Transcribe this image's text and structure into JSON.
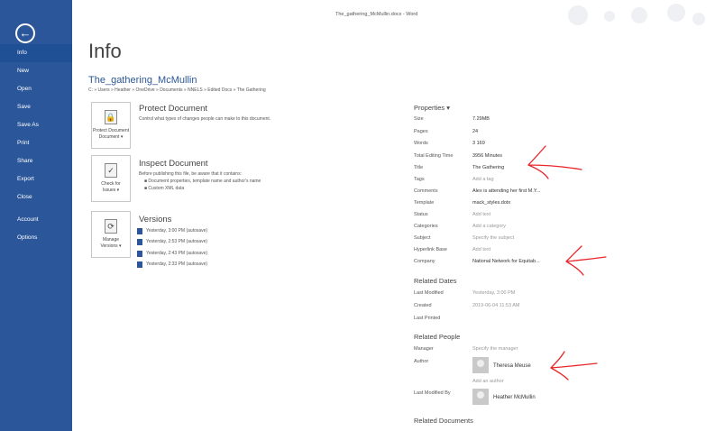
{
  "window": {
    "title": "The_gathering_McMullin.docx - Word"
  },
  "sidebar": {
    "back_icon": "back-arrow-icon",
    "items": [
      {
        "label": "Info",
        "active": true
      },
      {
        "label": "New"
      },
      {
        "label": "Open"
      },
      {
        "label": "Save"
      },
      {
        "label": "Save As"
      },
      {
        "label": "Print"
      },
      {
        "label": "Share"
      },
      {
        "label": "Export"
      },
      {
        "label": "Close"
      },
      {
        "label": "Account"
      },
      {
        "label": "Options"
      }
    ]
  },
  "main": {
    "title": "Info",
    "doc_name": "The_gathering_McMullin",
    "doc_path": "C: » Users » Heather » OneDrive » Documents » NNELS » Edited Docs » The Gathering",
    "protect": {
      "button": "Protect Document",
      "button_line2": "Document ▾",
      "title": "Protect Document",
      "desc": "Control what types of changes people can make to this document."
    },
    "inspect": {
      "button": "Check for",
      "button_line2": "Issues ▾",
      "title": "Inspect Document",
      "desc": "Before publishing this file, be aware that it contains:",
      "bullets": [
        "Document properties, template name and author's name",
        "Custom XML data"
      ]
    },
    "versions": {
      "button": "Manage",
      "button_line2": "Versions ▾",
      "title": "Versions",
      "items": [
        "Yesterday, 3:00 PM (autosave)",
        "Yesterday, 2:53 PM (autosave)",
        "Yesterday, 2:43 PM (autosave)",
        "Yesterday, 2:33 PM (autosave)"
      ]
    }
  },
  "properties": {
    "header": "Properties ▾",
    "rows": [
      {
        "label": "Size",
        "value": "7.29MB"
      },
      {
        "label": "Pages",
        "value": "24"
      },
      {
        "label": "Words",
        "value": "3 169"
      },
      {
        "label": "Total Editing Time",
        "value": "3956 Minutes"
      },
      {
        "label": "Title",
        "value": "The Gathering"
      },
      {
        "label": "Tags",
        "value": "Add a tag"
      },
      {
        "label": "Comments",
        "value": "Alex is attending her first M.Y..."
      },
      {
        "label": "Template",
        "value": "mack_styles.dotx"
      },
      {
        "label": "Status",
        "value": "Add text"
      },
      {
        "label": "Categories",
        "value": "Add a category"
      },
      {
        "label": "Subject",
        "value": "Specify the subject"
      },
      {
        "label": "Hyperlink Base",
        "value": "Add text"
      },
      {
        "label": "Company",
        "value": "National Network for Equitab..."
      }
    ],
    "related_dates": {
      "header": "Related Dates",
      "rows": [
        {
          "label": "Last Modified",
          "value": "Yesterday, 3:00 PM"
        },
        {
          "label": "Created",
          "value": "2019-06-04 11:53 AM"
        },
        {
          "label": "Last Printed",
          "value": ""
        }
      ]
    },
    "related_people": {
      "header": "Related People",
      "manager_label": "Manager",
      "manager_value": "Specify the manager",
      "author_label": "Author",
      "author_name": "Theresa Meuse",
      "add_author": "Add an author",
      "last_modified_label": "Last Modified By",
      "last_modified_name": "Heather McMullin"
    },
    "related_documents": {
      "header": "Related Documents"
    }
  },
  "colors": {
    "sidebar": "#2b579a",
    "annotation": "#e8262a"
  }
}
